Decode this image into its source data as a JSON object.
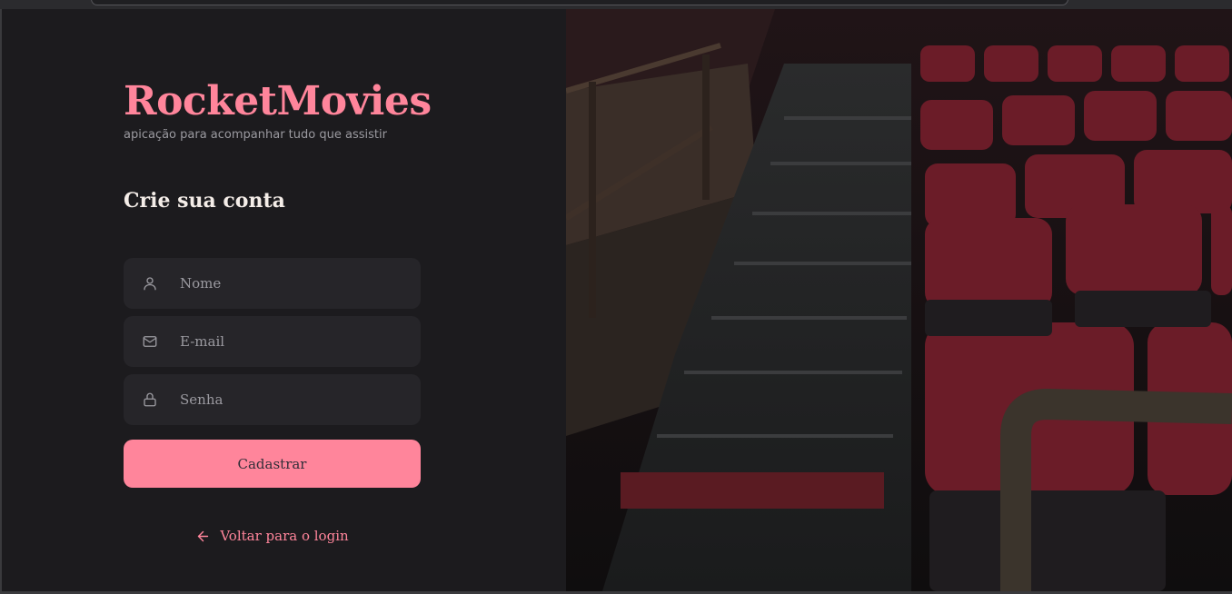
{
  "brand": {
    "title": "RocketMovies",
    "tagline": "apicação para acompanhar tudo que assistir"
  },
  "form": {
    "heading": "Crie sua conta",
    "fields": [
      {
        "icon": "user-icon",
        "placeholder": "Nome"
      },
      {
        "icon": "mail-icon",
        "placeholder": "E-mail"
      },
      {
        "icon": "lock-icon",
        "placeholder": "Senha"
      }
    ],
    "submit_label": "Cadastrar",
    "back_label": "Voltar para o login",
    "back_icon": "arrow-left-icon"
  },
  "colors": {
    "accent": "#ff859b",
    "background": "#1c1b1e",
    "input_background": "#262529",
    "heading": "#f4ede8",
    "muted": "#9b9aa0"
  }
}
